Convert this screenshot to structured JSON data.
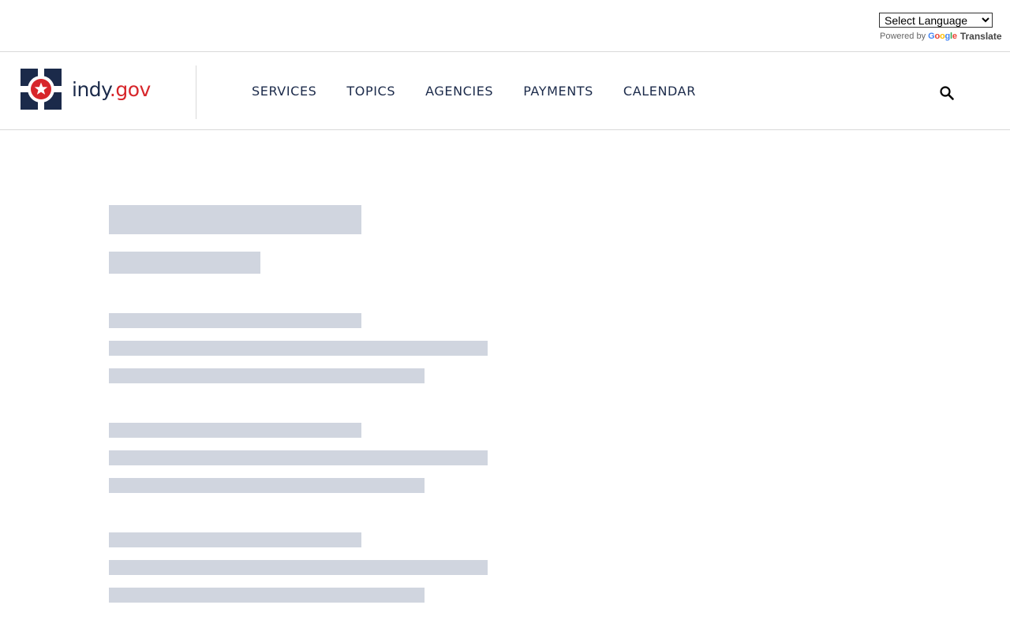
{
  "translate": {
    "select_value": "Select Language",
    "powered_by": "Powered by",
    "google_letters": [
      "G",
      "o",
      "o",
      "g",
      "l",
      "e"
    ],
    "translate_label": "Translate"
  },
  "header": {
    "logo_text_main": "indy",
    "logo_text_dot": ".",
    "logo_text_tld": "gov",
    "nav": [
      {
        "label": "SERVICES"
      },
      {
        "label": "TOPICS"
      },
      {
        "label": "AGENCIES"
      },
      {
        "label": "PAYMENTS"
      },
      {
        "label": "CALENDAR"
      }
    ],
    "search_icon": "search-icon"
  },
  "colors": {
    "navy": "#1b2a4a",
    "red": "#d7262b",
    "skeleton": "#d0d5df",
    "border": "#d9d9d9"
  }
}
